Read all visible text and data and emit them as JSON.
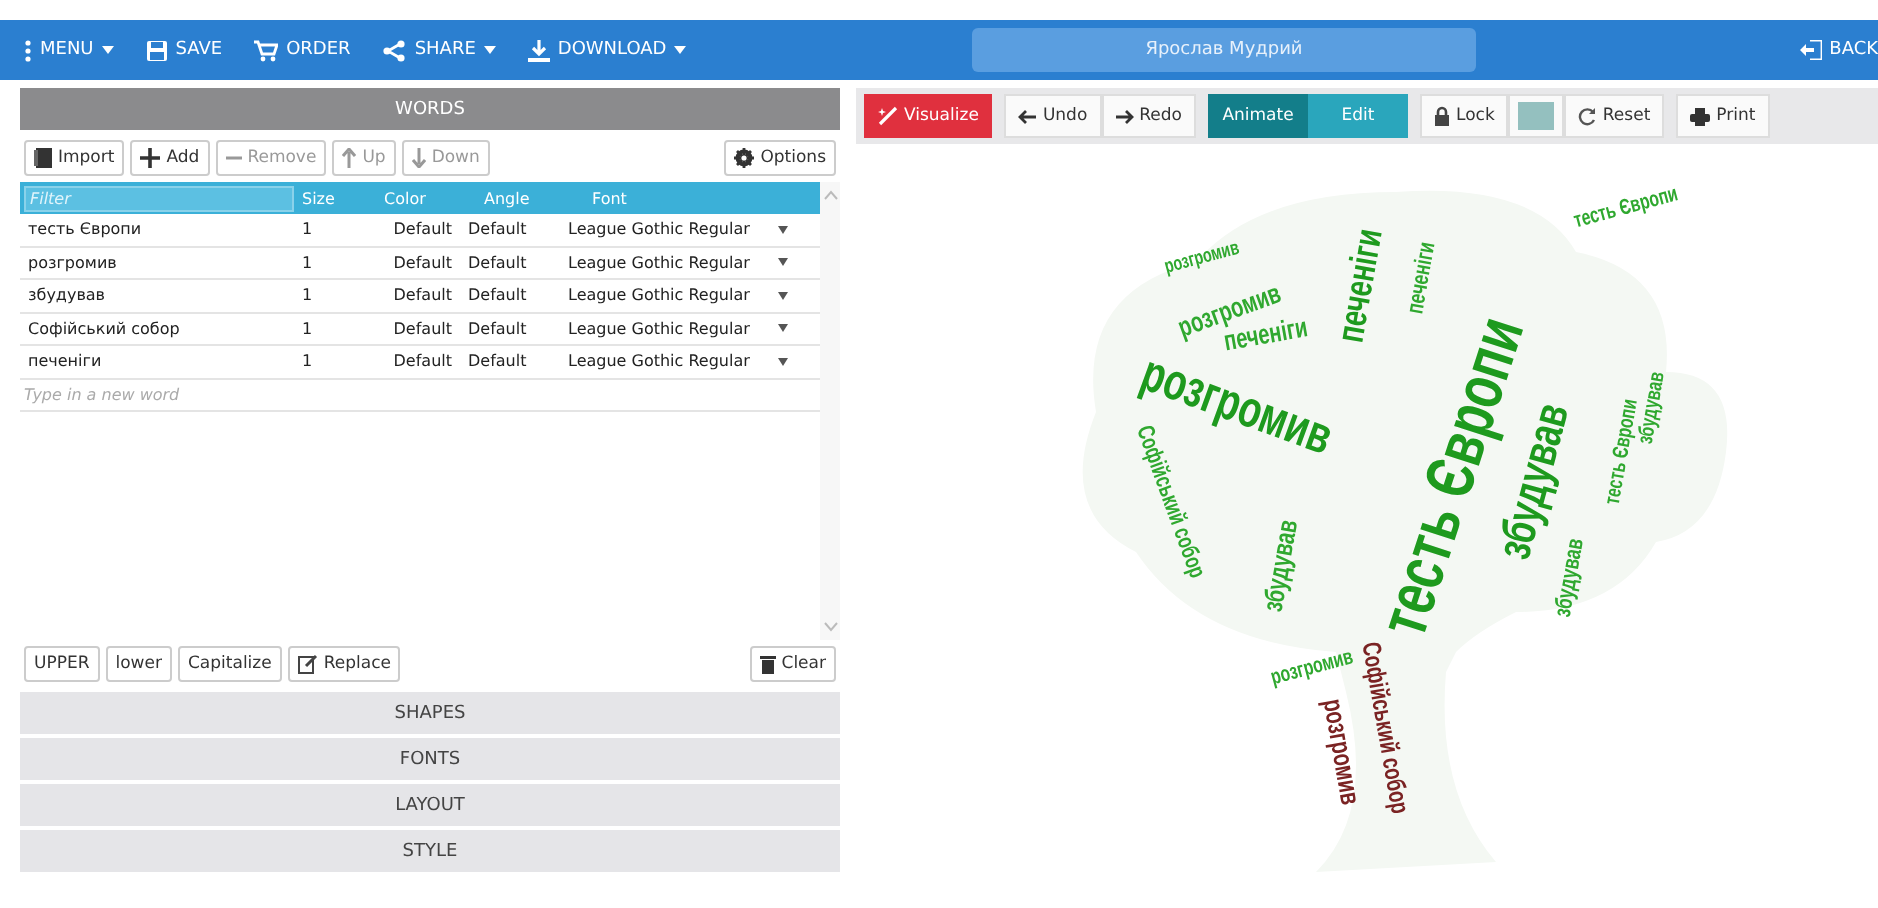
{
  "navbar": {
    "items": [
      {
        "label": "MENU",
        "caret": true
      },
      {
        "label": "SAVE",
        "caret": false
      },
      {
        "label": "ORDER",
        "caret": false
      },
      {
        "label": "SHARE",
        "caret": true
      },
      {
        "label": "DOWNLOAD",
        "caret": true
      }
    ],
    "title": "Ярослав Мудрий",
    "back": "BACK"
  },
  "words_panel": {
    "header": "WORDS",
    "toolbar": [
      {
        "label": "Import",
        "disabled": false
      },
      {
        "label": "Add",
        "disabled": false
      },
      {
        "label": "Remove",
        "disabled": true
      },
      {
        "label": "Up",
        "disabled": true
      },
      {
        "label": "Down",
        "disabled": true
      }
    ],
    "options": "Options",
    "table": {
      "filter_placeholder": "Filter",
      "columns": [
        "",
        "Size",
        "Color",
        "Angle",
        "Font"
      ],
      "rows": [
        [
          "тесть Європи",
          "1",
          "Default",
          "Default",
          "League Gothic Regular"
        ],
        [
          "розгромив",
          "1",
          "Default",
          "Default",
          "League Gothic Regular"
        ],
        [
          "збудував",
          "1",
          "Default",
          "Default",
          "League Gothic Regular"
        ],
        [
          "Софійський собор",
          "1",
          "Default",
          "Default",
          "League Gothic Regular"
        ],
        [
          "печеніги",
          "1",
          "Default",
          "Default",
          "League Gothic Regular"
        ]
      ],
      "new_word_placeholder": "Type in a new word"
    },
    "case_buttons": [
      "UPPER",
      "lower",
      "Capitalize"
    ],
    "replace": "Replace",
    "clear": "Clear"
  },
  "sections": [
    "SHAPES",
    "FONTS",
    "LAYOUT",
    "STYLE"
  ],
  "canvas_toolbar": {
    "visualize": "Visualize",
    "undo": "Undo",
    "redo": "Redo",
    "modes": [
      {
        "label": "Animate",
        "selected": true
      },
      {
        "label": "Edit",
        "selected": false
      }
    ],
    "lock": "Lock",
    "reset": "Reset",
    "print": "Print"
  },
  "cloud": {
    "words": [
      {
        "text": "тесть Європи",
        "color": "#1e9a1e"
      },
      {
        "text": "розгромив",
        "color": "#1e9a1e"
      },
      {
        "text": "збудував",
        "color": "#1e9a1e"
      },
      {
        "text": "печеніги",
        "color": "#1e9a1e"
      },
      {
        "text": "розгромив",
        "color": "#2fa82f"
      },
      {
        "text": "печеніги",
        "color": "#2fa82f"
      },
      {
        "text": "печеніги",
        "color": "#2fa82f"
      },
      {
        "text": "тесть Європи",
        "color": "#2fa82f"
      },
      {
        "text": "Софійський собор",
        "color": "#7a2323"
      },
      {
        "text": "розгромив",
        "color": "#7a2323"
      },
      {
        "text": "збудував",
        "color": "#2fa82f"
      },
      {
        "text": "розгромив",
        "color": "#2fa82f"
      },
      {
        "text": "Софійський собор",
        "color": "#2fa82f"
      },
      {
        "text": "тесть Європи",
        "color": "#2fa82f"
      },
      {
        "text": "збудував",
        "color": "#2fa82f"
      },
      {
        "text": "збудував",
        "color": "#2fa82f"
      },
      {
        "text": "розгромив",
        "color": "#2fa82f"
      }
    ]
  }
}
